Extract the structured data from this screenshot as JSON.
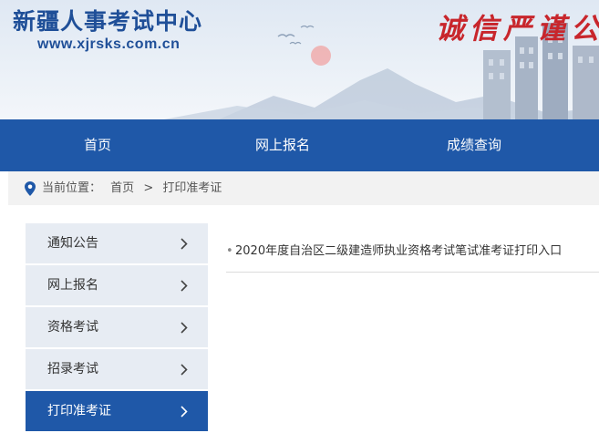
{
  "header": {
    "site_title": "新疆人事考试中心",
    "site_url": "www.xjrsks.com.cn",
    "slogan": "诚信严谨公"
  },
  "nav": {
    "items": [
      "首页",
      "网上报名",
      "成绩查询"
    ]
  },
  "breadcrumb": {
    "label": "当前位置：",
    "home": "首页",
    "separator": ">",
    "current": "打印准考证"
  },
  "sidebar": {
    "items": [
      {
        "label": "通知公告"
      },
      {
        "label": "网上报名"
      },
      {
        "label": "资格考试"
      },
      {
        "label": "招录考试"
      },
      {
        "label": "打印准考证"
      }
    ],
    "active_index": 4
  },
  "content": {
    "articles": [
      {
        "title": "2020年度自治区二级建造师执业资格考试笔试准考证打印入口"
      }
    ]
  },
  "colors": {
    "brand_blue": "#1f58a8",
    "title_blue": "#1f4f98",
    "slogan_red": "#c8262c",
    "sidebar_bg": "#e7ecf3"
  },
  "icons": [
    "location-pin-icon",
    "chevron-right-icon"
  ]
}
